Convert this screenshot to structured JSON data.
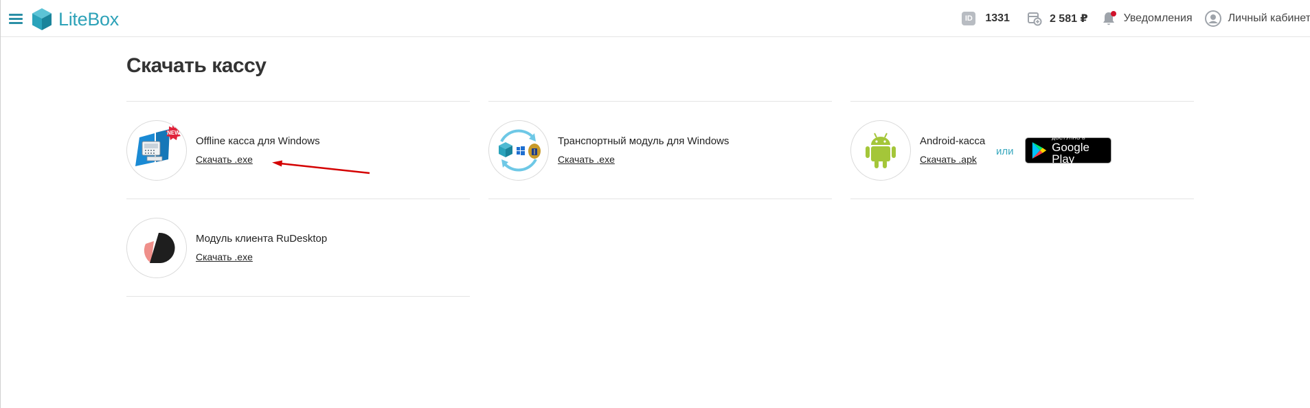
{
  "header": {
    "logo_text": "LiteBox",
    "id_badge": "ID",
    "id_value": "1331",
    "balance": "2 581 ₽",
    "notifications_label": "Уведомления",
    "account_label": "Личный кабинет",
    "accent_color": "#2ea2b8",
    "notification_dot_color": "#d0112b"
  },
  "page": {
    "title": "Скачать кассу"
  },
  "downloads": [
    {
      "title": "Offline касса для Windows",
      "link": "Скачать .exe",
      "icon": "offline-kassa-new-icon",
      "badge": "NEW"
    },
    {
      "title": "Транспортный модуль для Windows",
      "link": "Скачать .exe",
      "icon": "transport-module-icon"
    },
    {
      "title": "Android-касса",
      "link": "Скачать .apk",
      "icon": "android-icon",
      "or_label": "или",
      "store_badge_small": "ДОСТУПНО В",
      "store_badge_big": "Google Play"
    },
    {
      "title": "Модуль клиента RuDesktop",
      "link": "Скачать .exe",
      "icon": "rudesktop-icon"
    }
  ],
  "annotation": {
    "arrow_color": "#d40000"
  }
}
